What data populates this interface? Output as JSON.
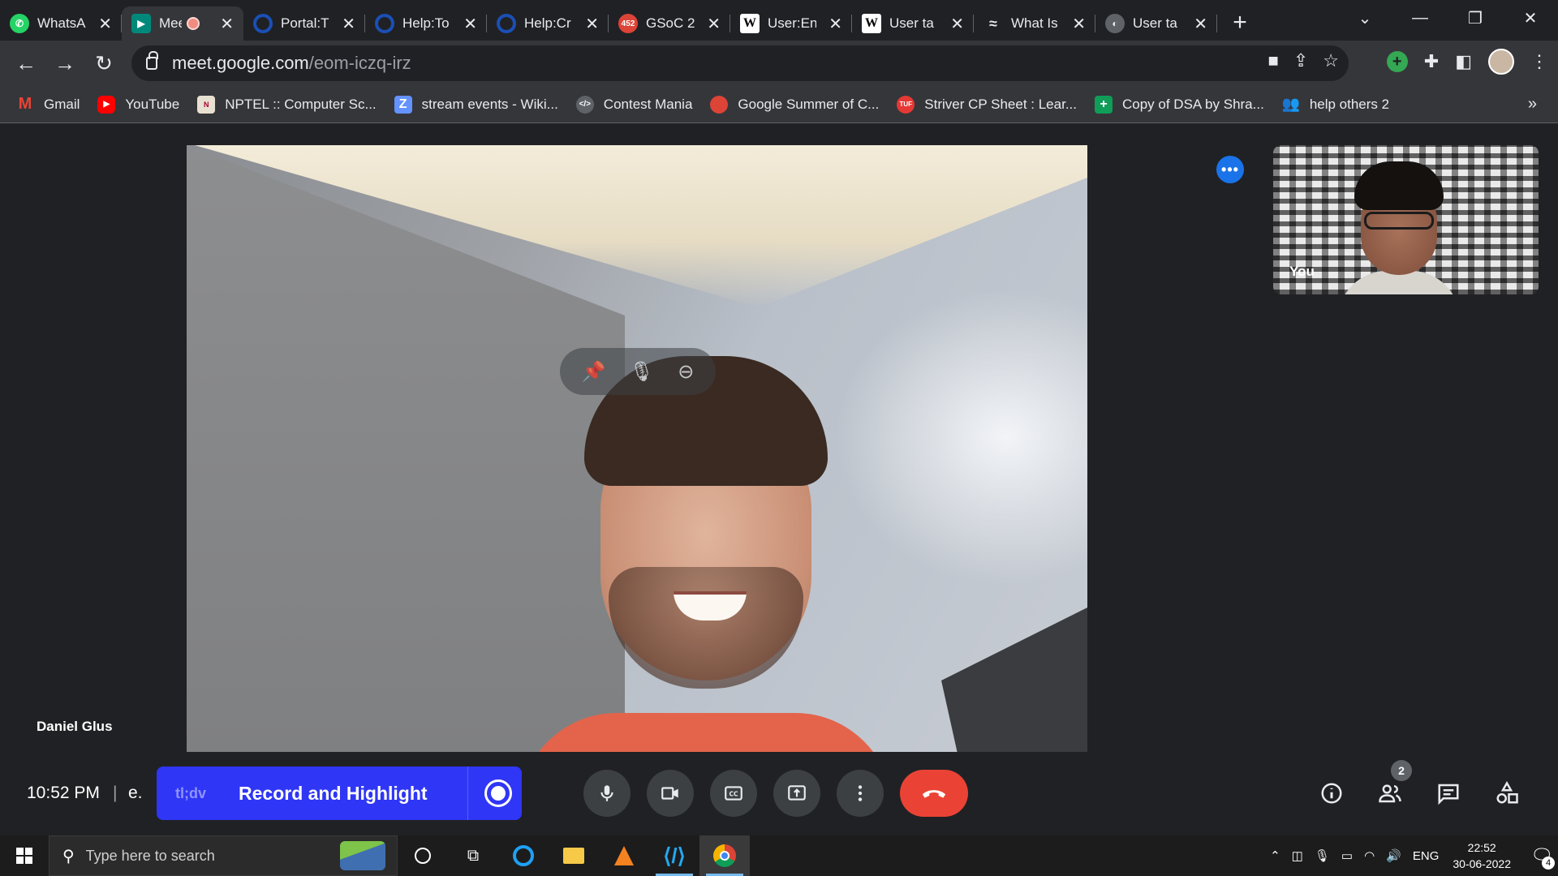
{
  "browser": {
    "tabs": [
      {
        "title": "WhatsApp",
        "favicon": "whatsapp-icon",
        "color": "#25d366"
      },
      {
        "title": "Meet",
        "favicon": "meet-icon",
        "color": "#00897b",
        "recording": true
      },
      {
        "title": "Portal:T",
        "favicon": "circle-icon",
        "color": "#1a4fb5"
      },
      {
        "title": "Help:To",
        "favicon": "circle-icon",
        "color": "#1a4fb5"
      },
      {
        "title": "Help:Cr",
        "favicon": "circle-icon",
        "color": "#1a4fb5"
      },
      {
        "title": "GSoC 2",
        "favicon": "gsoc-icon",
        "color": "#db4437",
        "badge": "452"
      },
      {
        "title": "User:En",
        "favicon": "wikipedia-icon",
        "color": "#ffffff"
      },
      {
        "title": "User ta",
        "favicon": "wikipedia-icon",
        "color": "#ffffff"
      },
      {
        "title": "What Is",
        "favicon": "zapier-icon",
        "color": "#cfcfcf"
      },
      {
        "title": "User ta",
        "favicon": "globe-icon",
        "color": "#9aa0a6"
      }
    ],
    "url_host": "meet.google.com",
    "url_path": "/eom-iczq-irz",
    "bookmarks": [
      {
        "label": "Gmail",
        "icon": "gmail-icon",
        "color": "#ea4335"
      },
      {
        "label": "YouTube",
        "icon": "youtube-icon",
        "color": "#ff0000"
      },
      {
        "label": "NPTEL :: Computer Sc...",
        "icon": "nptel-icon",
        "color": "#e8e0d0"
      },
      {
        "label": "stream events - Wiki...",
        "icon": "zulip-icon",
        "color": "#6492fe"
      },
      {
        "label": "Contest Mania",
        "icon": "code-icon",
        "color": "#5f6368"
      },
      {
        "label": "Google Summer of C...",
        "icon": "gsoc-icon",
        "color": "#db4437"
      },
      {
        "label": "Striver CP Sheet : Lear...",
        "icon": "tuf-icon",
        "color": "#e53935"
      },
      {
        "label": "Copy of DSA by Shra...",
        "icon": "sheets-icon",
        "color": "#0f9d58"
      },
      {
        "label": "help others 2",
        "icon": "people-icon",
        "color": "#8ab4f8"
      }
    ]
  },
  "meet": {
    "main_participant": "Daniel Glus",
    "self_label": "You",
    "time": "10:52 PM",
    "separator": "|",
    "meeting_code": "e.",
    "tldv_label": "tl;dv",
    "record_label": "Record and Highlight",
    "people_count": "2"
  },
  "taskbar": {
    "search_placeholder": "Type here to search",
    "language": "ENG",
    "clock_time": "22:52",
    "clock_date": "30-06-2022",
    "notifications": "4"
  }
}
